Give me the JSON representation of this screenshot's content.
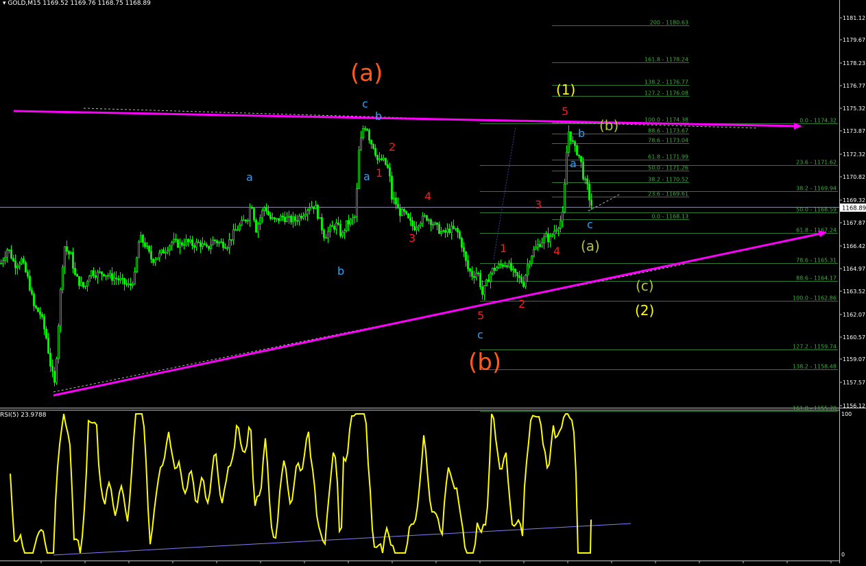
{
  "header": {
    "symbol": "GOLD,M15",
    "ohlc": "1169.52 1169.76 1168.75 1168.89"
  },
  "rsi_header": "RSI(5) 23.9788",
  "price_axis": [
    "1181.12",
    "1179.67",
    "1178.23",
    "1176.77",
    "1175.32",
    "1173.87",
    "1172.32",
    "1170.82",
    "1169.32",
    "1167.87",
    "1166.42",
    "1164.97",
    "1163.52",
    "1162.07",
    "1160.57",
    "1159.07",
    "1157.57",
    "1156.12"
  ],
  "current_price": "1168.89",
  "rsi_axis": {
    "top": "100",
    "bottom": "0"
  },
  "fib_right": [
    "0.0 - 1174.32",
    "23.6 - 1171.62",
    "38.2 - 1169.94",
    "50.0 - 1168.59",
    "61.8 - 1167.24",
    "78.6 - 1165.31",
    "88.6 - 1164.17",
    "100.0 - 1162.86",
    "127.2 - 1159.74",
    "138.2 - 1158.48",
    "161.8 - 1155.78"
  ],
  "fib_mid": [
    "200 - 1180.63",
    "161.8 - 1178.24",
    "138.2 - 1176.77",
    "127.2 - 1176.08",
    "100.0 - 1174.38",
    "88.6 - 1173.67",
    "78.6 - 1173.04",
    "61.8 - 1171.99",
    "50.0 - 1171.26",
    "38.2 - 1170.52",
    "23.6 - 1169.61",
    "0.0 - 1168.13"
  ],
  "wave_labels": {
    "big_a": "(a)",
    "big_b": "(b)",
    "wave1": "(1)",
    "wave2": "(2)",
    "sub_a": "(a)",
    "sub_b": "(b)",
    "sub_c": "(c)",
    "a": "a",
    "b": "b",
    "c": "c",
    "n1": "1",
    "n2": "2",
    "n3": "3",
    "n4": "4",
    "n5": "5"
  },
  "colors": {
    "candle": "#00ff00",
    "trendline": "#ff00ff",
    "rsi": "#ffff00",
    "rsi_support": "#8080ff",
    "fib": "#2e7d32",
    "orange_label": "#ff5a1a",
    "cyan_label": "#29a3ff",
    "red_label": "#ff1a1a",
    "yellow_label": "#ffff00",
    "olive_label": "#b5c33a"
  },
  "chart_data": {
    "type": "candlestick",
    "symbol": "GOLD",
    "timeframe": "M15",
    "ylim": [
      1155.7,
      1182.2
    ],
    "close_path": [
      [
        0,
        1165.3
      ],
      [
        10,
        1166.3
      ],
      [
        20,
        1165.2
      ],
      [
        30,
        1165.5
      ],
      [
        40,
        1164.2
      ],
      [
        48,
        1162.5
      ],
      [
        58,
        1162.0
      ],
      [
        66,
        1160.5
      ],
      [
        73,
        1158.5
      ],
      [
        78,
        1157.5
      ],
      [
        82,
        1160.0
      ],
      [
        87,
        1163.5
      ],
      [
        92,
        1166.5
      ],
      [
        97,
        1166.0
      ],
      [
        102,
        1165.8
      ],
      [
        108,
        1164.5
      ],
      [
        115,
        1164.0
      ],
      [
        122,
        1163.7
      ],
      [
        130,
        1164.8
      ],
      [
        140,
        1164.6
      ],
      [
        150,
        1164.7
      ],
      [
        160,
        1164.4
      ],
      [
        170,
        1164.3
      ],
      [
        180,
        1164.0
      ],
      [
        188,
        1163.8
      ],
      [
        195,
        1164.5
      ],
      [
        202,
        1167.0
      ],
      [
        210,
        1166.5
      ],
      [
        220,
        1165.5
      ],
      [
        230,
        1165.8
      ],
      [
        240,
        1166.2
      ],
      [
        250,
        1166.7
      ],
      [
        260,
        1166.5
      ],
      [
        270,
        1166.7
      ],
      [
        280,
        1166.5
      ],
      [
        290,
        1166.6
      ],
      [
        300,
        1166.2
      ],
      [
        310,
        1166.8
      ],
      [
        320,
        1166.6
      ],
      [
        330,
        1166.5
      ],
      [
        340,
        1167.3
      ],
      [
        350,
        1167.8
      ],
      [
        360,
        1168.3
      ],
      [
        365,
        1169.3
      ],
      [
        372,
        1167.5
      ],
      [
        380,
        1168.5
      ],
      [
        385,
        1169.0
      ],
      [
        392,
        1168.2
      ],
      [
        400,
        1168.0
      ],
      [
        410,
        1168.3
      ],
      [
        420,
        1168.1
      ],
      [
        430,
        1168.1
      ],
      [
        440,
        1168.5
      ],
      [
        450,
        1169.0
      ],
      [
        458,
        1169.0
      ],
      [
        465,
        1168.0
      ],
      [
        472,
        1167.0
      ],
      [
        480,
        1167.5
      ],
      [
        490,
        1167.8
      ],
      [
        497,
        1167.0
      ],
      [
        503,
        1167.8
      ],
      [
        510,
        1168.0
      ],
      [
        517,
        1168.3
      ],
      [
        522,
        1172.5
      ],
      [
        528,
        1174.0
      ],
      [
        533,
        1174.2
      ],
      [
        538,
        1173.2
      ],
      [
        544,
        1172.8
      ],
      [
        550,
        1171.8
      ],
      [
        556,
        1172.0
      ],
      [
        562,
        1171.6
      ],
      [
        566,
        1171.2
      ],
      [
        570,
        1169.5
      ],
      [
        575,
        1169.3
      ],
      [
        580,
        1168.6
      ],
      [
        588,
        1168.5
      ],
      [
        595,
        1168.0
      ],
      [
        602,
        1167.6
      ],
      [
        610,
        1168.0
      ],
      [
        620,
        1168.3
      ],
      [
        628,
        1168.0
      ],
      [
        635,
        1167.6
      ],
      [
        645,
        1167.2
      ],
      [
        655,
        1167.5
      ],
      [
        665,
        1167.4
      ],
      [
        672,
        1166.5
      ],
      [
        680,
        1165.0
      ],
      [
        688,
        1164.5
      ],
      [
        695,
        1164.8
      ],
      [
        702,
        1163.3
      ],
      [
        708,
        1164.0
      ],
      [
        715,
        1164.8
      ],
      [
        722,
        1165.0
      ],
      [
        730,
        1165.2
      ],
      [
        738,
        1165.3
      ],
      [
        745,
        1164.8
      ],
      [
        750,
        1164.5
      ],
      [
        756,
        1164.3
      ],
      [
        762,
        1164.0
      ],
      [
        768,
        1165.2
      ],
      [
        775,
        1166.0
      ],
      [
        782,
        1166.4
      ],
      [
        790,
        1166.8
      ],
      [
        795,
        1167.0
      ],
      [
        800,
        1166.8
      ],
      [
        808,
        1167.5
      ],
      [
        815,
        1167.9
      ],
      [
        820,
        1168.5
      ],
      [
        824,
        1172.0
      ],
      [
        828,
        1173.8
      ],
      [
        832,
        1173.3
      ],
      [
        836,
        1172.7
      ],
      [
        840,
        1172.5
      ],
      [
        845,
        1172.0
      ],
      [
        850,
        1170.7
      ],
      [
        855,
        1170.2
      ],
      [
        858,
        1169.5
      ],
      [
        862,
        1168.9
      ]
    ],
    "rsi_period": 5,
    "rsi_last": 23.9788,
    "rsi_range": [
      0,
      100
    ]
  }
}
